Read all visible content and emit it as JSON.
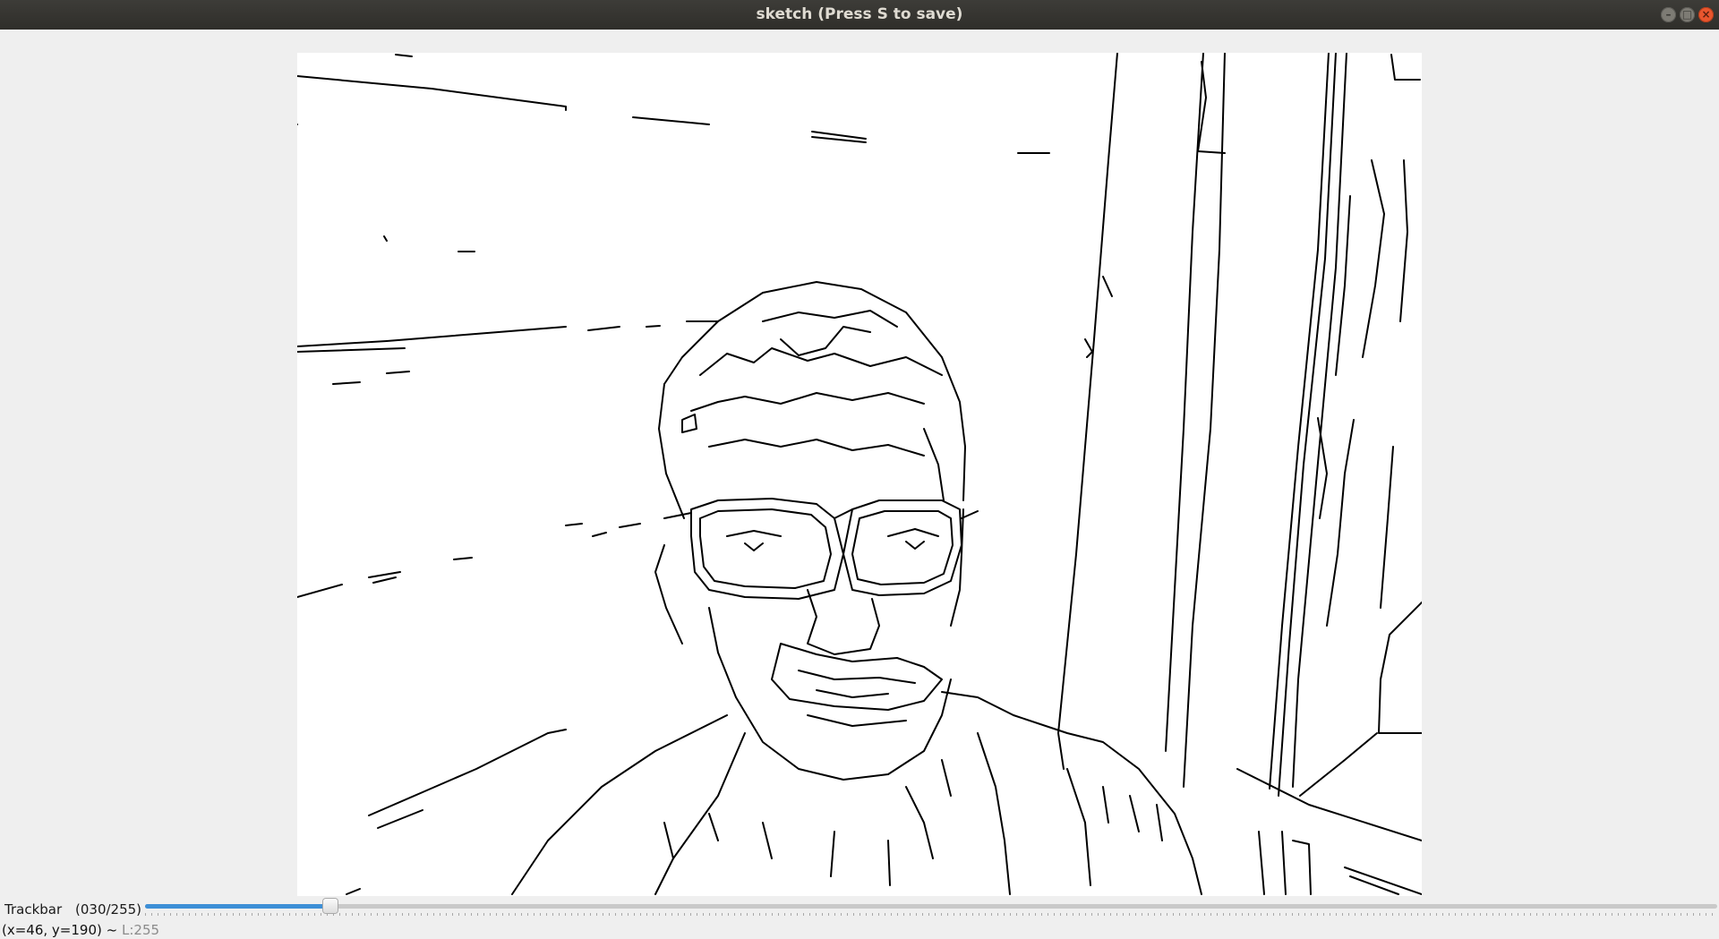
{
  "window": {
    "title": "sketch (Press S to save)",
    "buttons": {
      "minimize": "–",
      "maximize": "□",
      "close": "×"
    }
  },
  "image": {
    "description_icon": "edge-sketch-image"
  },
  "trackbar": {
    "label": "Trackbar",
    "value_text": "(030/255)",
    "value": 30,
    "max": 255,
    "fill_color": "#3d8fd6"
  },
  "status": {
    "coords": "(x=46, y=190)",
    "separator": "~",
    "level": "L:255"
  }
}
